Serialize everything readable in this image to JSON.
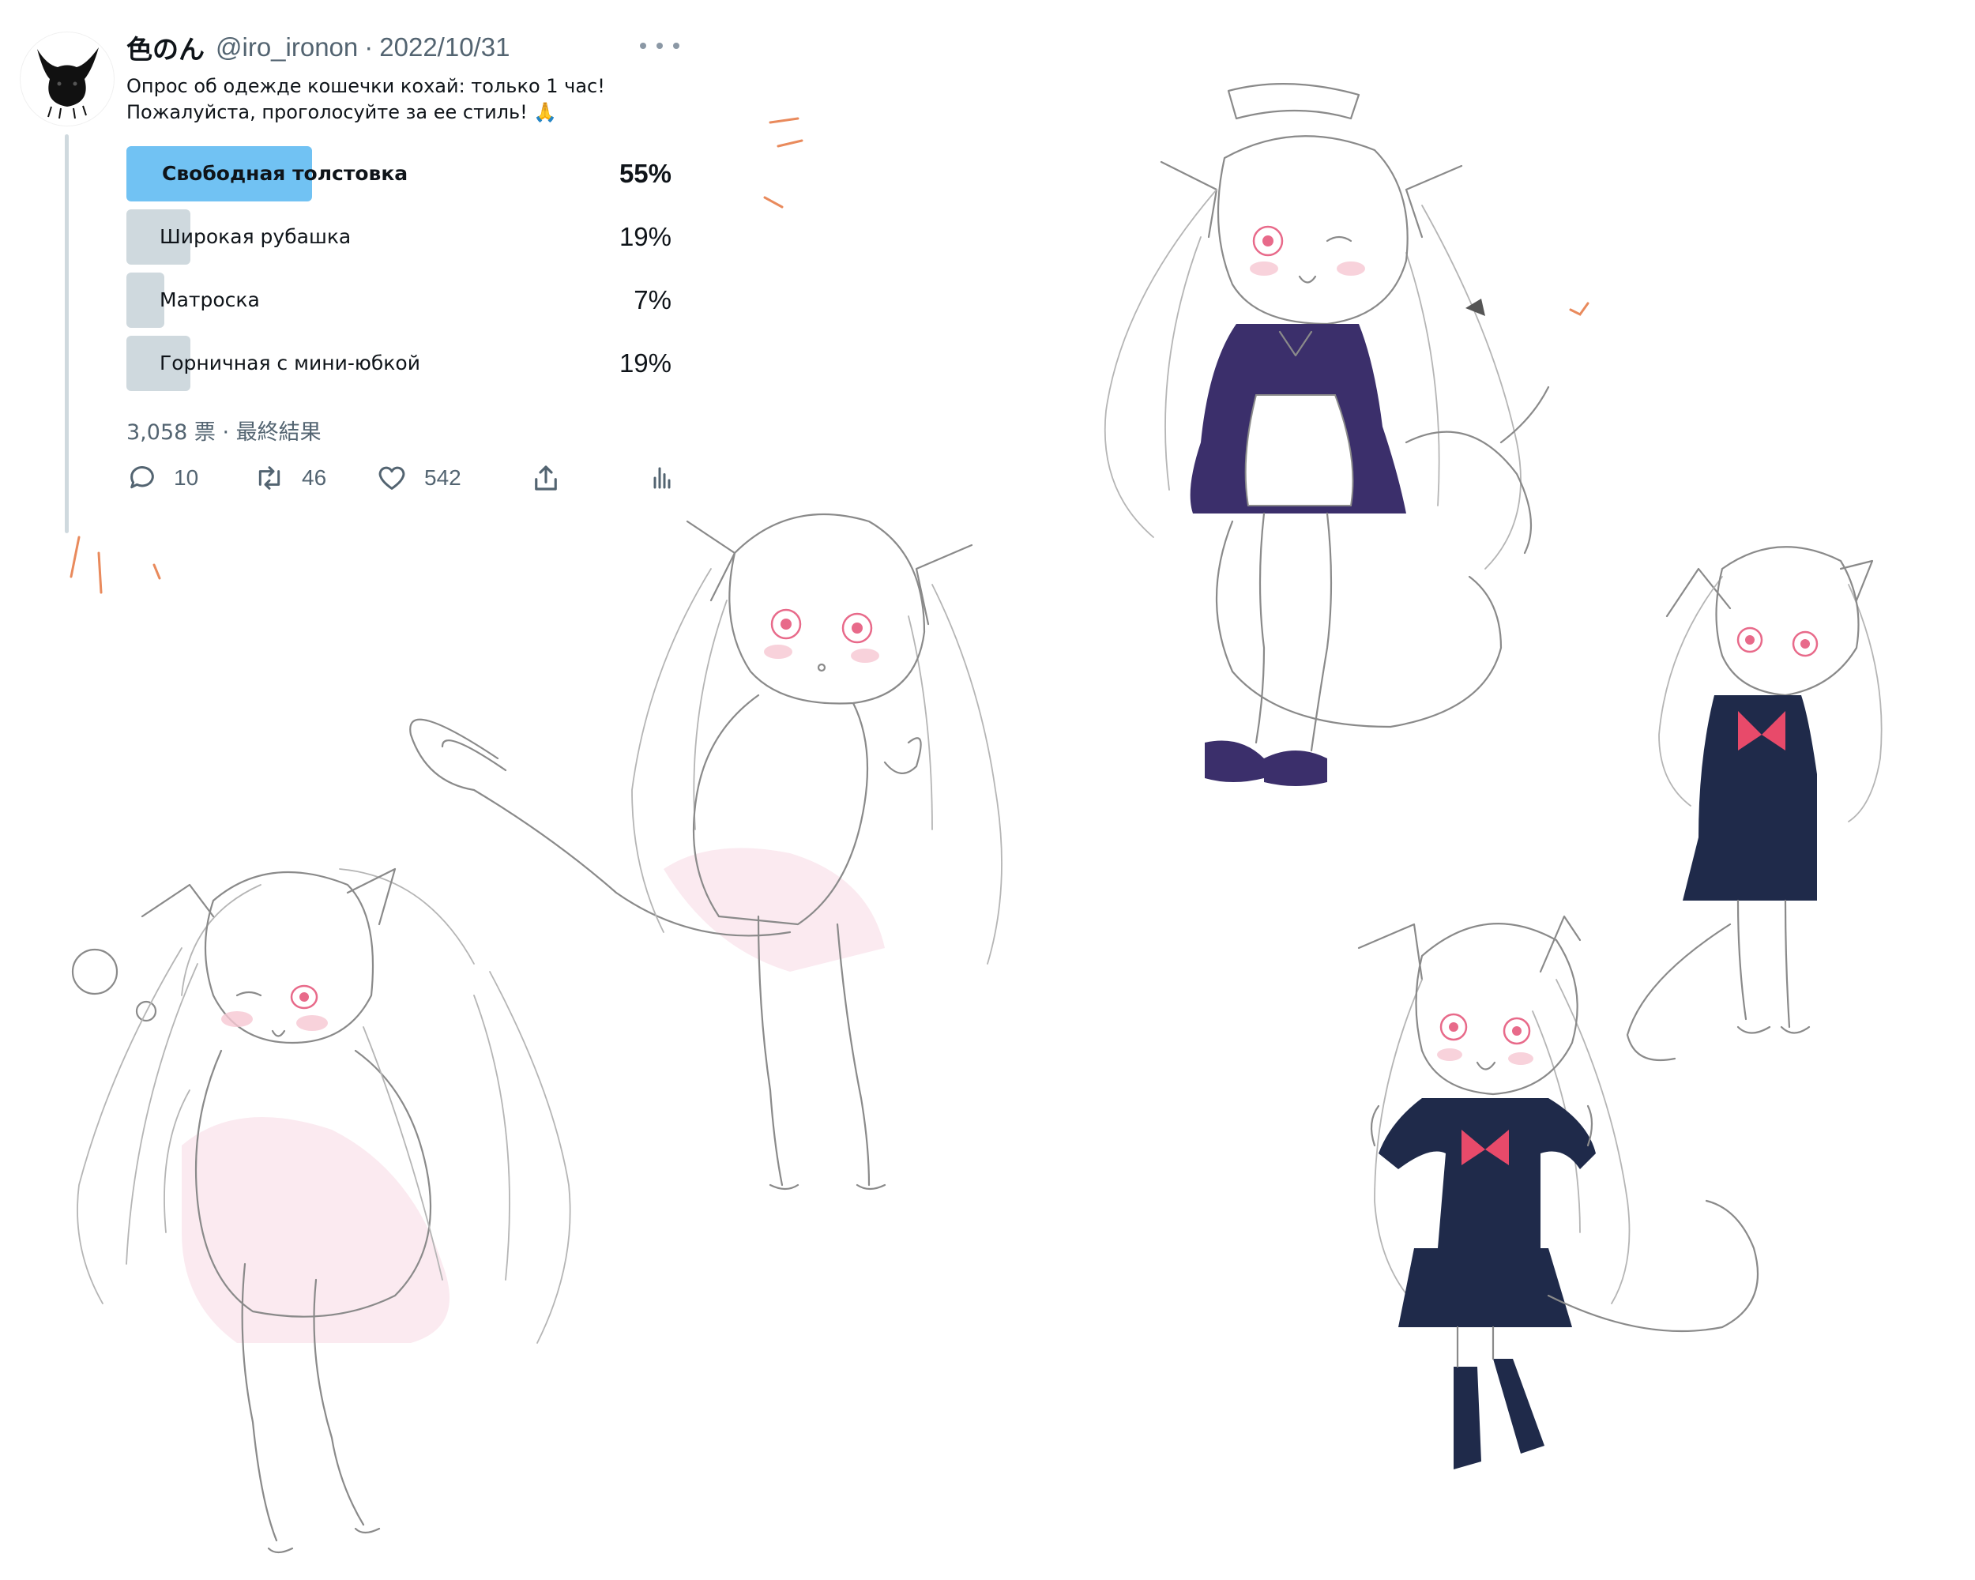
{
  "tweet": {
    "author_name": "色のん",
    "handle": "@iro_ironon",
    "separator": "·",
    "date": "2022/10/31",
    "text_line1": "Опрос об одежде кошечки кохай: только 1 час!",
    "text_line2": "Пожалуйста, проголосуйте за ее стиль! 🙏",
    "poll": {
      "options": [
        {
          "label": "Свободная толстовка",
          "percent": "55%",
          "fraction": 0.55,
          "winner": true
        },
        {
          "label": "Широкая рубашка",
          "percent": "19%",
          "fraction": 0.19,
          "winner": false
        },
        {
          "label": "Матроска",
          "percent": "7%",
          "fraction": 0.07,
          "winner": false
        },
        {
          "label": "Горничная с мини-юбкой",
          "percent": "19%",
          "fraction": 0.19,
          "winner": false
        }
      ],
      "votes": "3,058 票",
      "separator": "·",
      "status": "最終結果"
    },
    "actions": {
      "replies": "10",
      "retweets": "46",
      "likes": "542"
    },
    "colors": {
      "winner_bar": "#71c2f3",
      "other_bar": "#cfd9de",
      "secondary_text": "#536471",
      "accent_strokes": "#e98a5c",
      "uniform_navy": "#1f2a4a",
      "maid_purple": "#3b2f6b",
      "bow_red": "#e84a6a",
      "eye_pink": "#e86a8a"
    },
    "icons": [
      "reply-icon",
      "retweet-icon",
      "like-icon",
      "share-icon",
      "analytics-icon",
      "more-icon"
    ]
  },
  "illustrations": [
    {
      "name": "cat-girl-hoodie-figure"
    },
    {
      "name": "cat-girl-shirt-figure"
    },
    {
      "name": "cat-girl-maid-figure"
    },
    {
      "name": "cat-girl-sailor-figure"
    },
    {
      "name": "cat-girl-sailor-standing-figure"
    }
  ]
}
